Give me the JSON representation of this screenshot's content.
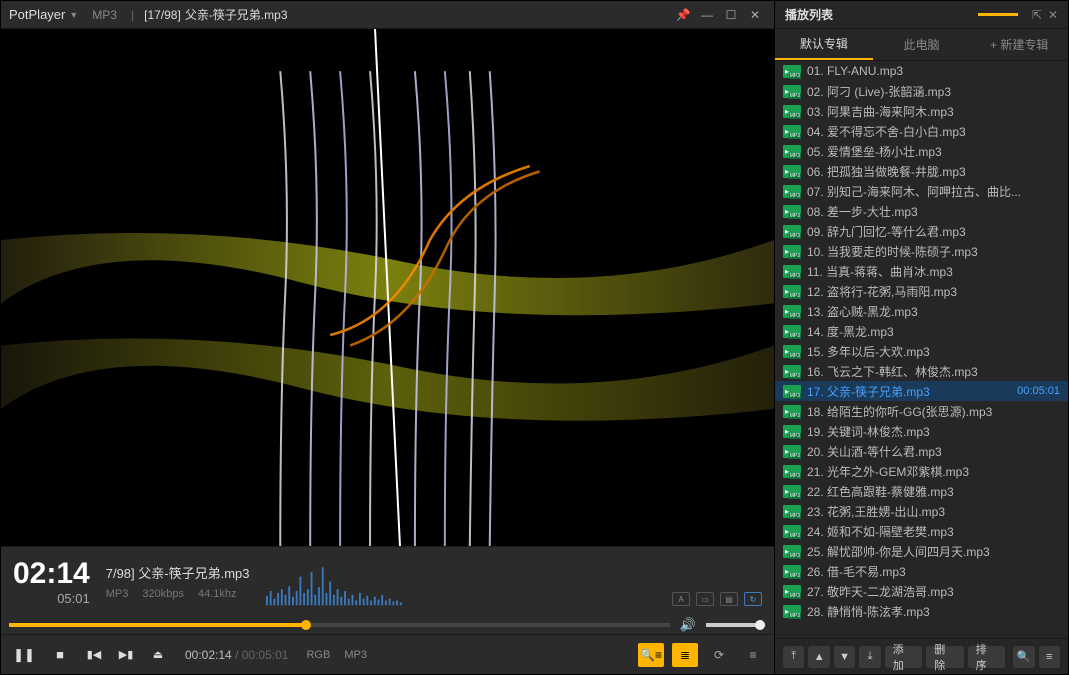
{
  "app_name": "PotPlayer",
  "title_format": "MP3",
  "title_index": "[17/98]",
  "title_track": "父亲-筷子兄弟.mp3",
  "win": {
    "pin": "📌",
    "min": "—",
    "max": "☐",
    "close": "✕"
  },
  "time": {
    "current_big": "02:14",
    "total_big": "05:01",
    "current": "00:02:14",
    "total": "00:05:01"
  },
  "short_index": "7/98]",
  "short_name": "父亲-筷子兄弟.mp3",
  "meta": {
    "fmt": "MP3",
    "bitrate": "320kbps",
    "rate": "44.1khz"
  },
  "tags": {
    "rgb": "RGB",
    "mp3": "MP3"
  },
  "volume_icon": "🔊",
  "ctrl": {
    "pause": "❚❚",
    "stop": "■",
    "prev": "▮◀",
    "next": "▶▮",
    "eject": "⏏",
    "search": "🔍≡",
    "list": "≣",
    "cycle": "⟳",
    "menu": "≡"
  },
  "side": {
    "title": "播放列表",
    "pin": "⇱",
    "close": "✕",
    "tabs": [
      "默认专辑",
      "此电脑",
      "+ 新建专辑"
    ],
    "items": [
      {
        "t": "01. FLY-ANU.mp3"
      },
      {
        "t": "02. 阿刁 (Live)-张韶涵.mp3"
      },
      {
        "t": "03. 阿果吉曲-海来阿木.mp3"
      },
      {
        "t": "04. 爱不得忘不舍-白小白.mp3"
      },
      {
        "t": "05. 爱情堡垒-杨小壮.mp3"
      },
      {
        "t": "06. 把孤独当做晚餐-井胧.mp3"
      },
      {
        "t": "07. 别知己-海来阿木、阿呷拉古、曲比..."
      },
      {
        "t": "08. 差一步-大壮.mp3"
      },
      {
        "t": "09. 辞九门回忆-等什么君.mp3"
      },
      {
        "t": "10. 当我要走的时候-陈硕子.mp3"
      },
      {
        "t": "11. 当真-蒋蒋、曲肖冰.mp3"
      },
      {
        "t": "12. 盗将行-花粥,马雨阳.mp3"
      },
      {
        "t": "13. 盗心贼-黑龙.mp3"
      },
      {
        "t": "14. 度-黑龙.mp3"
      },
      {
        "t": "15. 多年以后-大欢.mp3"
      },
      {
        "t": "16. 飞云之下-韩红、林俊杰.mp3"
      },
      {
        "t": "17. 父亲-筷子兄弟.mp3",
        "active": true,
        "dur": "00:05:01"
      },
      {
        "t": "18. 给陌生的你听-GG(张思源).mp3"
      },
      {
        "t": "19. 关键词-林俊杰.mp3"
      },
      {
        "t": "20. 关山酒-等什么君.mp3"
      },
      {
        "t": "21. 光年之外-GEM邓紫棋.mp3"
      },
      {
        "t": "22. 红色高跟鞋-蔡健雅.mp3"
      },
      {
        "t": "23. 花粥,王胜娚-出山.mp3"
      },
      {
        "t": "24. 姬和不如-隔壁老樊.mp3"
      },
      {
        "t": "25. 解忧邵帅-你是人间四月天.mp3"
      },
      {
        "t": "26. 借-毛不易.mp3"
      },
      {
        "t": "27. 敬昨天-二龙湖浩哥.mp3"
      },
      {
        "t": "28. 静悄悄-陈泫孝.mp3"
      }
    ],
    "foot": {
      "up_all": "⤒",
      "up": "▲",
      "down": "▼",
      "down_all": "⤓",
      "add": "添加",
      "del": "删除",
      "sort": "排序",
      "search": "🔍",
      "menu": "≡"
    }
  }
}
